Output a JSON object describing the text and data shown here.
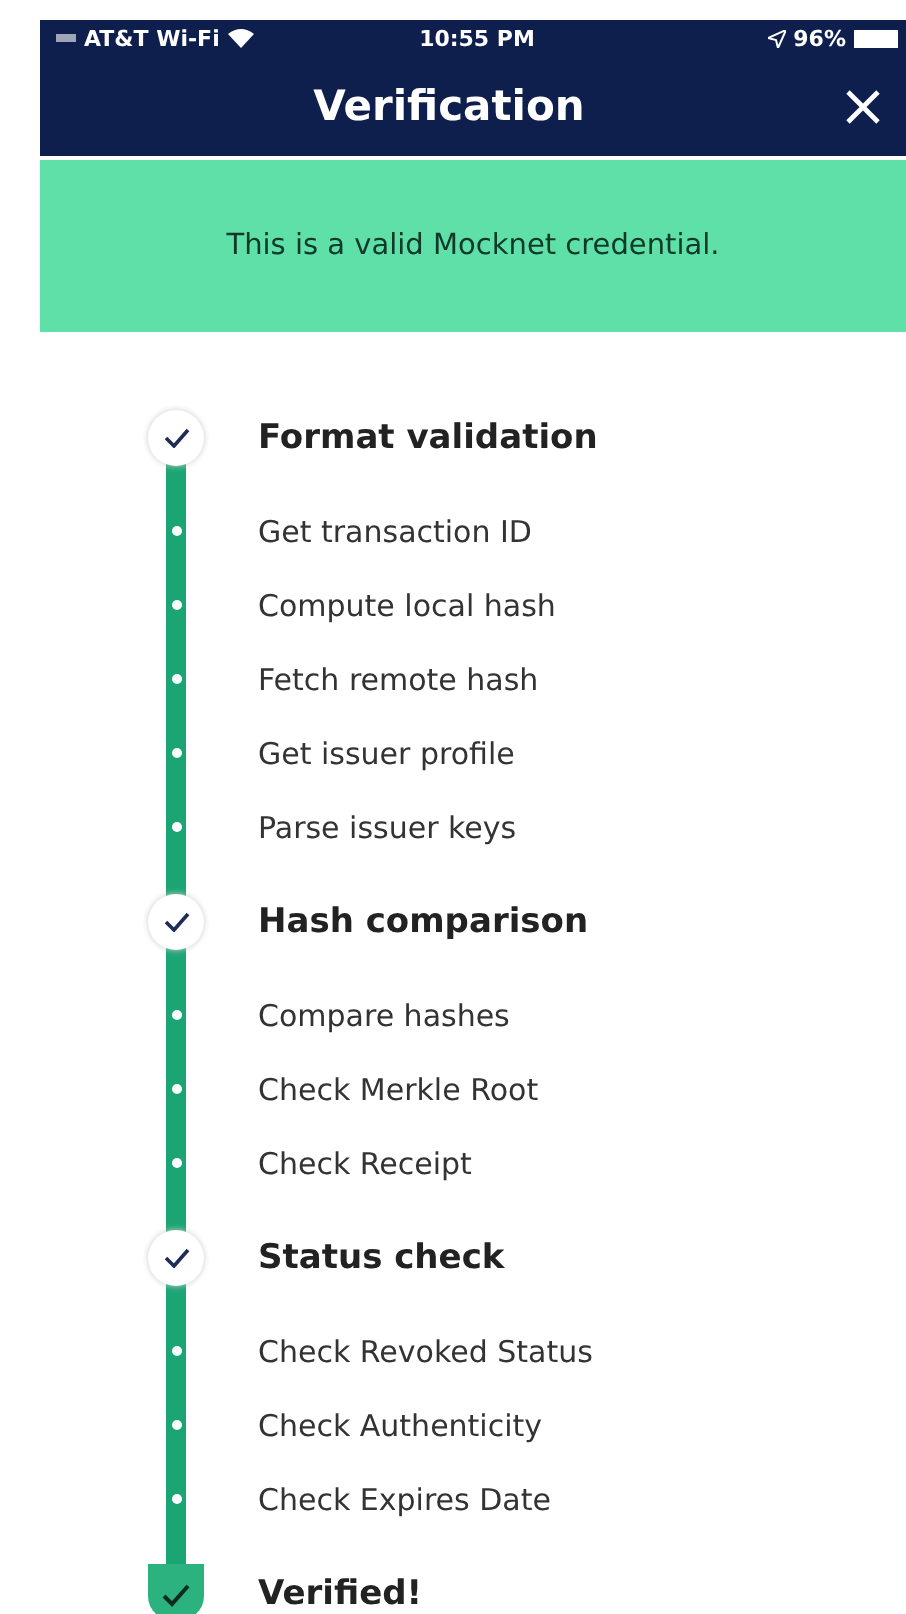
{
  "status_bar": {
    "carrier": "AT&T Wi-Fi",
    "time": "10:55 PM",
    "battery": "96%"
  },
  "header": {
    "title": "Verification"
  },
  "banner": {
    "text": "This is a valid Mocknet credential."
  },
  "steps": [
    {
      "kind": "group",
      "label": "Format validation"
    },
    {
      "kind": "step",
      "label": "Get transaction ID"
    },
    {
      "kind": "step",
      "label": "Compute local hash"
    },
    {
      "kind": "step",
      "label": "Fetch remote hash"
    },
    {
      "kind": "step",
      "label": "Get issuer profile"
    },
    {
      "kind": "step",
      "label": "Parse issuer keys"
    },
    {
      "kind": "group",
      "label": "Hash comparison"
    },
    {
      "kind": "step",
      "label": "Compare hashes"
    },
    {
      "kind": "step",
      "label": "Check Merkle Root"
    },
    {
      "kind": "step",
      "label": "Check Receipt"
    },
    {
      "kind": "group",
      "label": "Status check"
    },
    {
      "kind": "step",
      "label": "Check Revoked Status"
    },
    {
      "kind": "step",
      "label": "Check Authenticity"
    },
    {
      "kind": "step",
      "label": "Check Expires Date"
    },
    {
      "kind": "final",
      "label": "Verified!"
    }
  ]
}
